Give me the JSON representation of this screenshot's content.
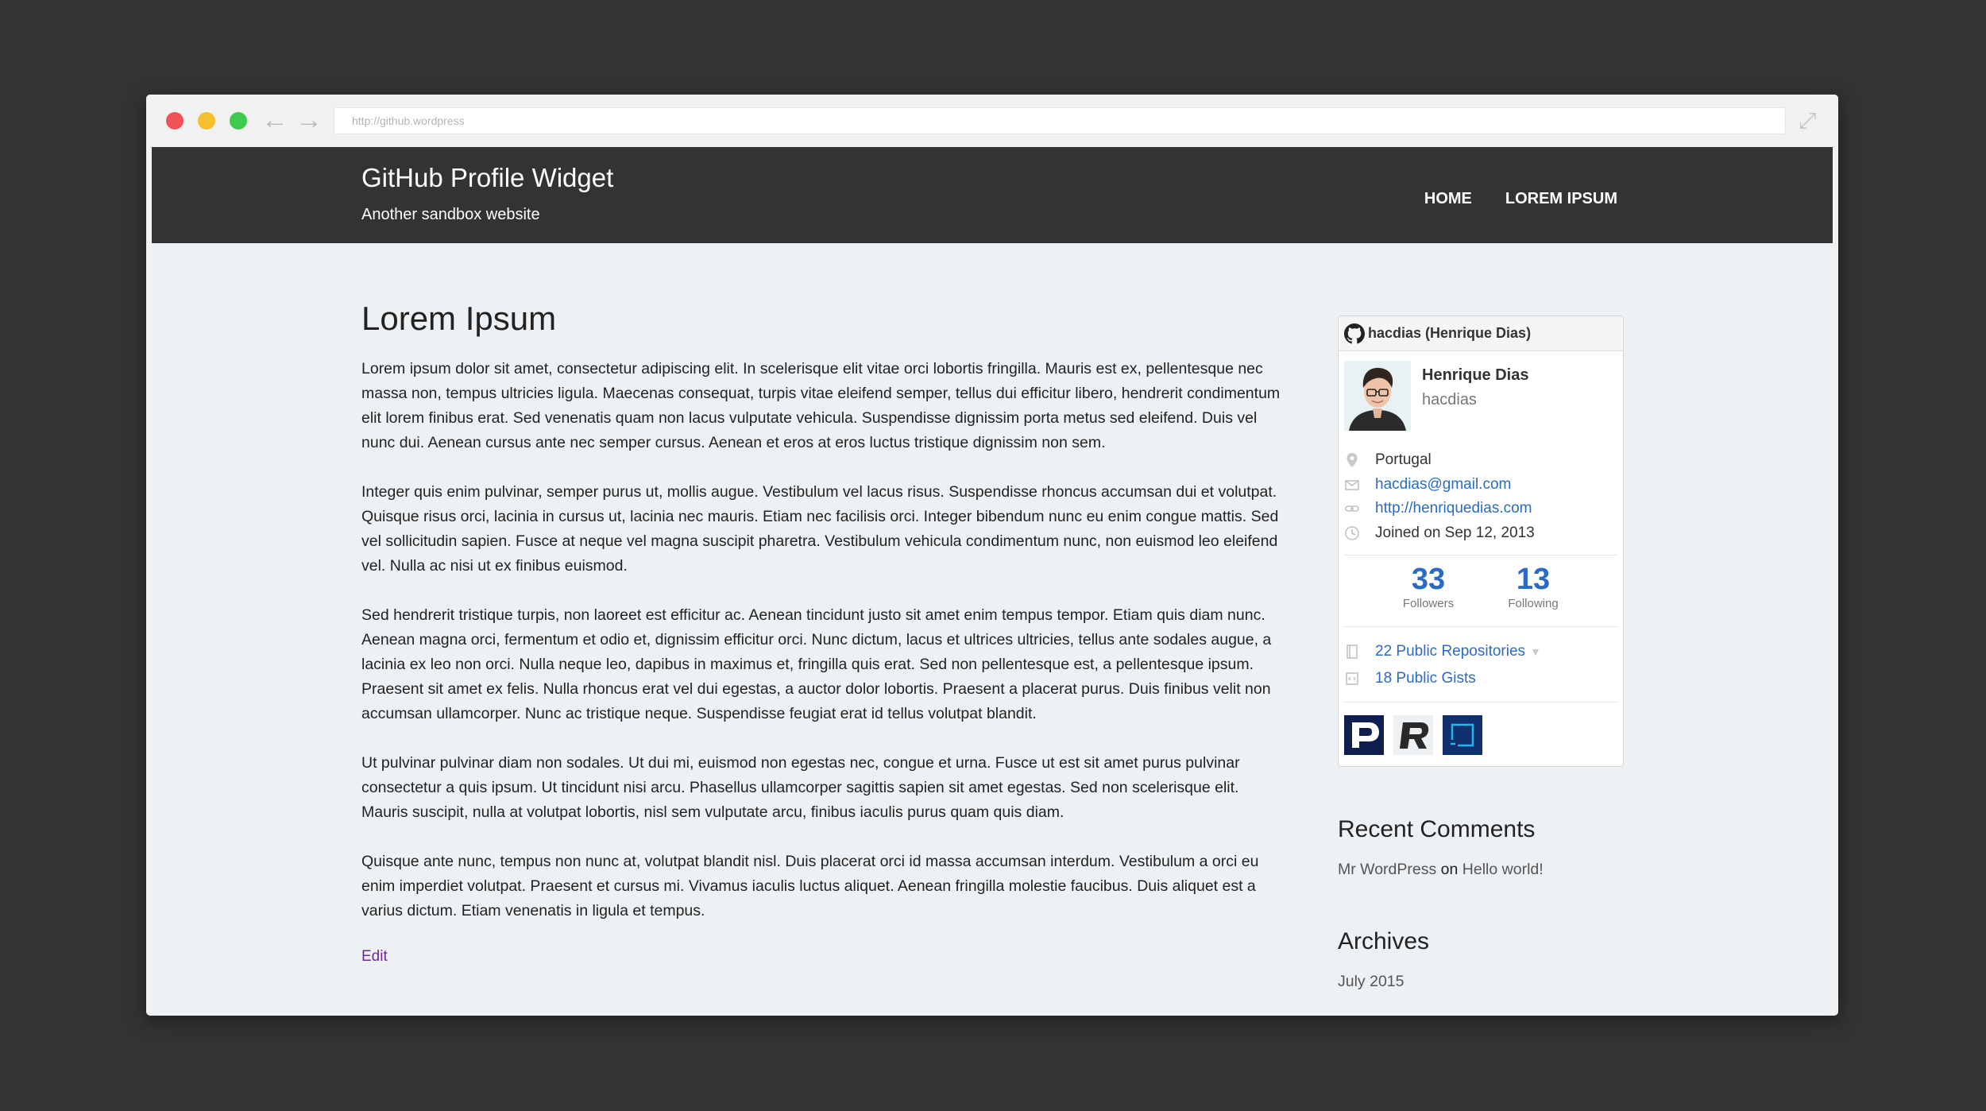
{
  "browser": {
    "url": "http://github.wordpress",
    "back_icon": "arrow-left-icon",
    "forward_icon": "arrow-right-icon",
    "expand_icon": "expand-icon"
  },
  "site": {
    "title": "GitHub Profile Widget",
    "description": "Another sandbox website",
    "menu": [
      "HOME",
      "LOREM IPSUM"
    ]
  },
  "post": {
    "title": "Lorem Ipsum",
    "paragraphs": [
      "Lorem ipsum dolor sit amet, consectetur adipiscing elit. In scelerisque elit vitae orci lobortis fringilla. Mauris est ex, pellentesque nec massa non, tempus ultricies ligula. Maecenas consequat, turpis vitae eleifend semper, tellus dui efficitur libero, hendrerit condimentum elit lorem finibus erat. Sed venenatis quam non lacus vulputate vehicula. Suspendisse dignissim porta metus sed eleifend. Duis vel nunc dui. Aenean cursus ante nec semper cursus. Aenean et eros at eros luctus tristique dignissim non sem.",
      "Integer quis enim pulvinar, semper purus ut, mollis augue. Vestibulum vel lacus risus. Suspendisse rhoncus accumsan dui et volutpat. Quisque risus orci, lacinia in cursus ut, lacinia nec mauris. Etiam nec facilisis orci. Integer bibendum nunc eu enim congue mattis. Sed vel sollicitudin sapien. Fusce at neque vel magna suscipit pharetra. Vestibulum vehicula condimentum nunc, non euismod leo eleifend vel. Nulla ac nisi ut ex finibus euismod.",
      "Sed hendrerit tristique turpis, non laoreet est efficitur ac. Aenean tincidunt justo sit amet enim tempus tempor. Etiam quis diam nunc. Aenean magna orci, fermentum et odio et, dignissim efficitur orci. Nunc dictum, lacus et ultrices ultricies, tellus ante sodales augue, a lacinia ex leo non orci. Nulla neque leo, dapibus in maximus et, fringilla quis erat. Sed non pellentesque est, a pellentesque ipsum. Praesent sit amet ex felis. Nulla rhoncus erat vel dui egestas, a auctor dolor lobortis. Praesent a placerat purus. Duis finibus velit non accumsan ullamcorper. Nunc ac tristique neque. Suspendisse feugiat erat id tellus volutpat blandit.",
      "Ut pulvinar pulvinar diam non sodales. Ut dui mi, euismod non egestas nec, congue et urna. Fusce ut est sit amet purus pulvinar consectetur a quis ipsum. Ut tincidunt nisi arcu. Phasellus ullamcorper sagittis sapien sit amet egestas. Sed non scelerisque elit. Mauris suscipit, nulla at volutpat lobortis, nisl sem vulputate arcu, finibus iaculis purus quam quis diam.",
      "Quisque ante nunc, tempus non nunc at, volutpat blandit nisl. Duis placerat orci id massa accumsan interdum. Vestibulum a orci eu enim imperdiet volutpat. Praesent et cursus mi. Vivamus iaculis luctus aliquet. Aenean fringilla molestie faucibus. Duis aliquet est a varius dictum. Etiam venenatis in ligula et tempus."
    ],
    "edit_label": "Edit"
  },
  "github_widget": {
    "header": "hacdias (Henrique Dias)",
    "header_icon": "github-icon",
    "name": "Henrique Dias",
    "login": "hacdias",
    "location": "Portugal",
    "email": "hacdias@gmail.com",
    "website": "http://henriquedias.com",
    "joined": "Joined on Sep 12, 2013",
    "followers_count": "33",
    "followers_label": "Followers",
    "following_count": "13",
    "following_label": "Following",
    "repos": "22 Public Repositories",
    "gists": "18 Public Gists",
    "orgs": [
      "org-logo-p",
      "org-logo-r",
      "org-logo-square"
    ]
  },
  "recent_comments": {
    "title": "Recent Comments",
    "author": "Mr WordPress",
    "on": "on",
    "post": "Hello world!"
  },
  "archives": {
    "title": "Archives",
    "items": [
      "July 2015"
    ]
  },
  "colors": {
    "outer_background": "#333333",
    "masthead": "#333333",
    "page_background": "#eef1f4",
    "link_blue": "#2b6bc4",
    "edit_purple": "#6f2a96",
    "close_red": "#f25356",
    "minimize_yellow": "#f7bf2e",
    "zoom_green": "#3fcb4d"
  }
}
